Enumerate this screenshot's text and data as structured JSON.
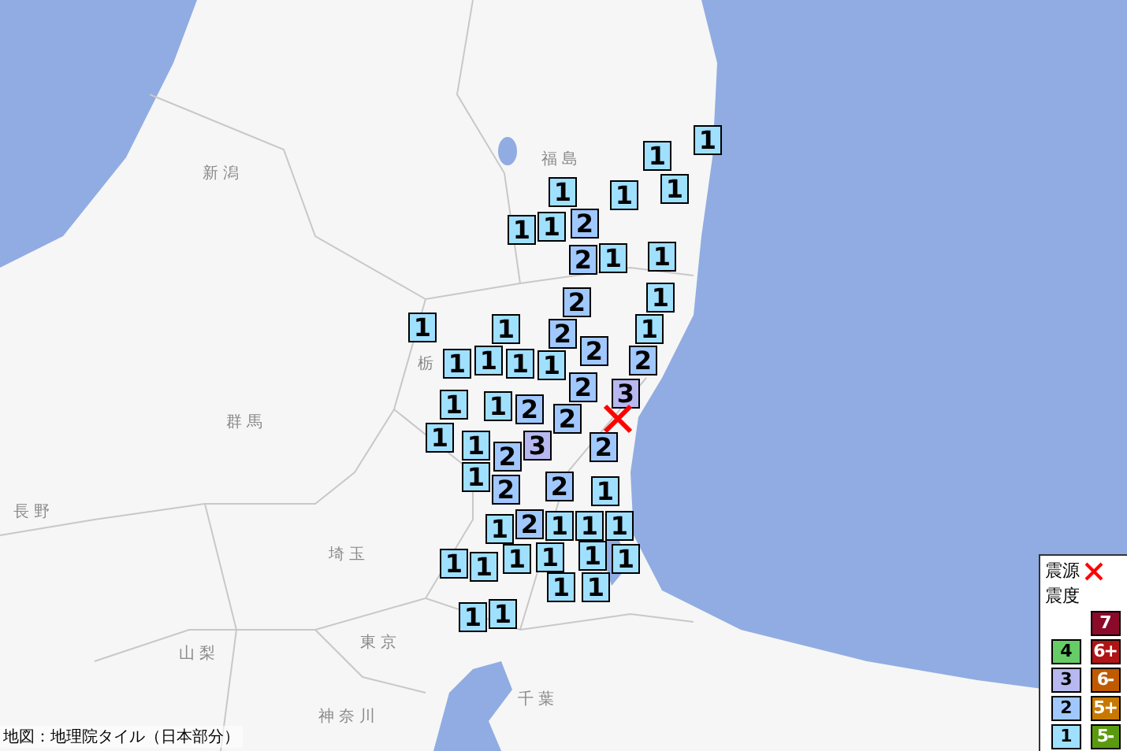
{
  "map": {
    "region_labels": [
      {
        "text": "新 潟"
      },
      {
        "text": "福 島"
      },
      {
        "text": "栃"
      },
      {
        "text": "群 馬"
      },
      {
        "text": "長 野"
      },
      {
        "text": "埼 玉"
      },
      {
        "text": "東 京"
      },
      {
        "text": "山 梨"
      },
      {
        "text": "神 奈 川"
      },
      {
        "text": "千 葉"
      }
    ],
    "markers": [
      {
        "intensity": "1",
        "color": "#a0e0ff"
      },
      {
        "intensity": "1",
        "color": "#a0e0ff"
      },
      {
        "intensity": "1",
        "color": "#a0e0ff"
      },
      {
        "intensity": "1",
        "color": "#a0e0ff"
      },
      {
        "intensity": "1",
        "color": "#a0e0ff"
      },
      {
        "intensity": "1",
        "color": "#a0e0ff"
      },
      {
        "intensity": "1",
        "color": "#a0e0ff"
      },
      {
        "intensity": "2",
        "color": "#a0c8ff"
      },
      {
        "intensity": "2",
        "color": "#a0c8ff"
      },
      {
        "intensity": "1",
        "color": "#a0e0ff"
      },
      {
        "intensity": "1",
        "color": "#a0e0ff"
      },
      {
        "intensity": "2",
        "color": "#a0c8ff"
      },
      {
        "intensity": "1",
        "color": "#a0e0ff"
      },
      {
        "intensity": "1",
        "color": "#a0e0ff"
      },
      {
        "intensity": "1",
        "color": "#a0e0ff"
      },
      {
        "intensity": "2",
        "color": "#a0c8ff"
      },
      {
        "intensity": "1",
        "color": "#a0e0ff"
      },
      {
        "intensity": "1",
        "color": "#a0e0ff"
      },
      {
        "intensity": "1",
        "color": "#a0e0ff"
      },
      {
        "intensity": "1",
        "color": "#a0e0ff"
      },
      {
        "intensity": "1",
        "color": "#a0e0ff"
      },
      {
        "intensity": "2",
        "color": "#a0c8ff"
      },
      {
        "intensity": "2",
        "color": "#a0c8ff"
      },
      {
        "intensity": "1",
        "color": "#a0e0ff"
      },
      {
        "intensity": "1",
        "color": "#a0e0ff"
      },
      {
        "intensity": "2",
        "color": "#a0c8ff"
      },
      {
        "intensity": "2",
        "color": "#a0c8ff"
      },
      {
        "intensity": "2",
        "color": "#a0c8ff"
      },
      {
        "intensity": "3",
        "color": "#b8b8f0"
      },
      {
        "intensity": "1",
        "color": "#a0e0ff"
      },
      {
        "intensity": "1",
        "color": "#a0e0ff"
      },
      {
        "intensity": "2",
        "color": "#a0c8ff"
      },
      {
        "intensity": "3",
        "color": "#b8b8f0"
      },
      {
        "intensity": "2",
        "color": "#a0c8ff"
      },
      {
        "intensity": "1",
        "color": "#a0e0ff"
      },
      {
        "intensity": "2",
        "color": "#a0c8ff"
      },
      {
        "intensity": "2",
        "color": "#a0c8ff"
      },
      {
        "intensity": "1",
        "color": "#a0e0ff"
      },
      {
        "intensity": "1",
        "color": "#a0e0ff"
      },
      {
        "intensity": "2",
        "color": "#a0c8ff"
      },
      {
        "intensity": "1",
        "color": "#a0e0ff"
      },
      {
        "intensity": "1",
        "color": "#a0e0ff"
      },
      {
        "intensity": "1",
        "color": "#a0e0ff"
      },
      {
        "intensity": "1",
        "color": "#a0e0ff"
      },
      {
        "intensity": "1",
        "color": "#a0e0ff"
      },
      {
        "intensity": "1",
        "color": "#a0e0ff"
      },
      {
        "intensity": "1",
        "color": "#a0e0ff"
      },
      {
        "intensity": "1",
        "color": "#a0e0ff"
      },
      {
        "intensity": "1",
        "color": "#a0e0ff"
      },
      {
        "intensity": "1",
        "color": "#a0e0ff"
      },
      {
        "intensity": "1",
        "color": "#a0e0ff"
      },
      {
        "intensity": "1",
        "color": "#a0e0ff"
      },
      {
        "intensity": "1",
        "color": "#a0e0ff"
      }
    ],
    "attribution": "地図：地理院タイル（日本部分）"
  },
  "legend": {
    "epicenter_label": "震源",
    "intensity_label": "震度",
    "scale_column_1": [
      {
        "label": "4",
        "color": "#66cc66"
      },
      {
        "label": "3",
        "color": "#b8b8f0"
      },
      {
        "label": "2",
        "color": "#a0c8ff"
      },
      {
        "label": "1",
        "color": "#a0e0ff"
      }
    ],
    "scale_column_2": [
      {
        "label": "7",
        "color": "#8b0a2a"
      },
      {
        "label": "6+",
        "color": "#b01414"
      },
      {
        "label": "6-",
        "color": "#c05a00"
      },
      {
        "label": "5+",
        "color": "#c87800"
      },
      {
        "label": "5-",
        "color": "#5a9a10"
      }
    ]
  }
}
